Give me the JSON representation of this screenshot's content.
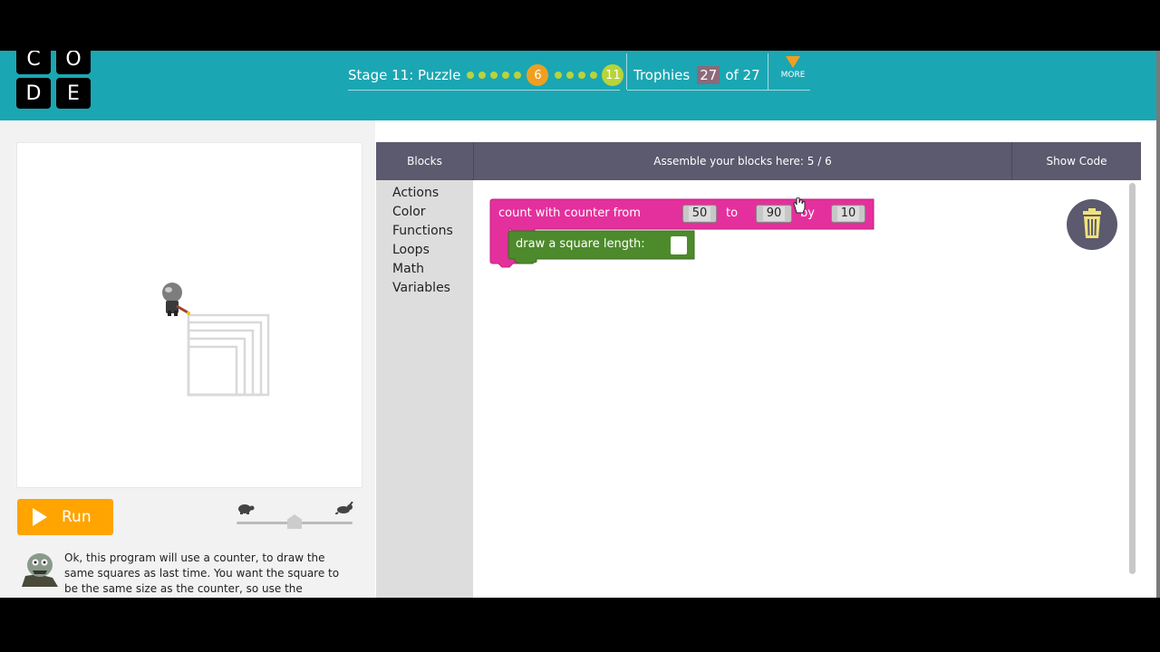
{
  "logo": {
    "letters": [
      "C",
      "O",
      "D",
      "E"
    ]
  },
  "header": {
    "stage_label": "Stage 11: Puzzle",
    "progress": {
      "dots_before": 5,
      "current": "6",
      "dots_after": 4,
      "last": "11"
    },
    "trophies_label": "Trophies",
    "trophies_count": "27",
    "trophies_of": "of 27",
    "more_label": "MORE"
  },
  "controls": {
    "run_label": "Run",
    "speed_level": 0.5
  },
  "instructions": {
    "text": "Ok, this program will use a counter, to draw the same squares as last time. You want the square to be the same size as the counter, so use the"
  },
  "workspace": {
    "header": {
      "blocks_label": "Blocks",
      "assemble_label": "Assemble your blocks here: 5 / 6",
      "show_code_label": "Show Code"
    },
    "categories": [
      "Actions",
      "Color",
      "Functions",
      "Loops",
      "Math",
      "Variables"
    ],
    "blocks": {
      "count": {
        "prefix": "count with  counter  from",
        "from": "50",
        "to_label": "to",
        "to": "90",
        "by_label": "by",
        "by": "10",
        "color": "#e4309c"
      },
      "draw": {
        "label": "draw a square  length:",
        "color": "#4d8a2c"
      }
    }
  },
  "colors": {
    "header": "#1ba6b3",
    "run": "#ffa400",
    "workspace_header": "#5b5a6e",
    "toolbox": "#dddddd"
  }
}
